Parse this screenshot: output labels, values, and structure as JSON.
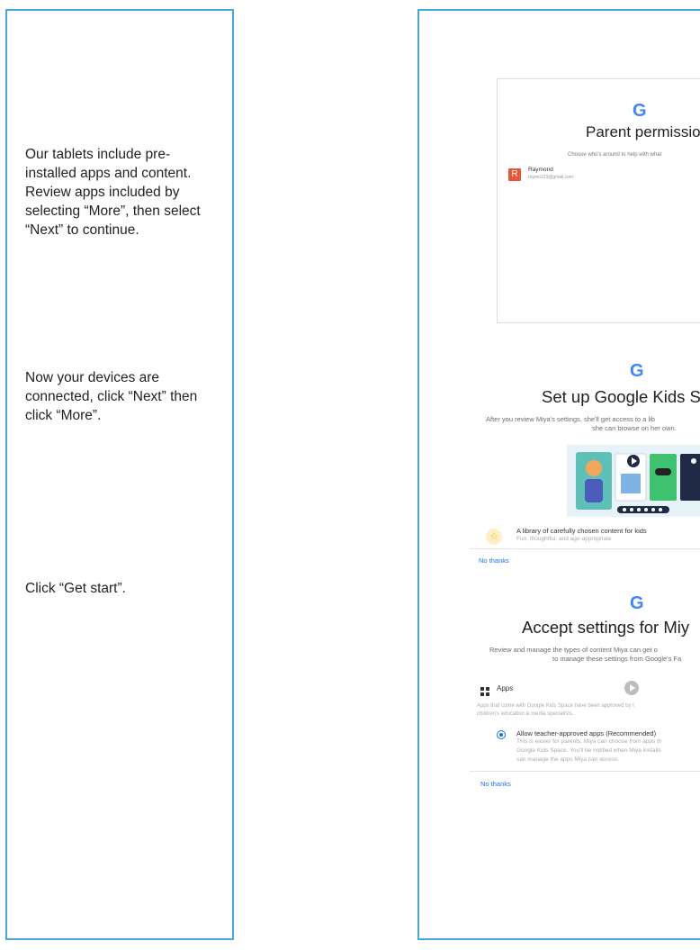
{
  "instructions": [
    "Our tablets include pre-installed apps and content. Review apps included by selecting “More”, then select “Next” to continue.",
    "Now your devices are connected, click “Next” then click “More”.",
    "Click “Get start”."
  ],
  "colors": {
    "panel_border": "#4aa8d8",
    "google_blue": "#4285F4",
    "google_red": "#EA4335",
    "google_yellow": "#FBBC05",
    "google_green": "#34A853",
    "link_blue": "#1a73e8"
  },
  "screen1": {
    "logo": "G",
    "title": "Parent permissio",
    "subtitle": "Choose who's around to help with what",
    "account": {
      "initial": "R",
      "name": "Raymond",
      "email": "raymo123@gmail.com"
    }
  },
  "screen2": {
    "logo": "G",
    "title": "Set up Google Kids S",
    "subtitle_line1": "After you review Miya's settings, she'll get access to a lib",
    "subtitle_line2": "she can browse on her own.",
    "feature_title": "A library of carefully chosen content for kids",
    "feature_sub": "Fun, thoughtful, and age-appropriate",
    "no_thanks": "No thanks"
  },
  "screen3": {
    "logo": "G",
    "title": "Accept settings for Miy",
    "subtitle_line1": "Review and manage the types of content Miya can get o",
    "subtitle_line2": "to manage these settings from Google's Fa",
    "apps_label": "Apps",
    "apps_desc_line1": "Apps that come with Google Kids Space have been approved by t",
    "apps_desc_line2": "children's education & media specialists.",
    "option_title": "Allow teacher-approved apps (Recommended)",
    "option_desc_line1": "This is easier for parents. Miya can choose from apps th",
    "option_desc_line2": "Google Kids Space. You'll be notified when Miya installs",
    "option_desc_line3": "can manage the apps Miya can access.",
    "no_thanks": "No thanks"
  }
}
